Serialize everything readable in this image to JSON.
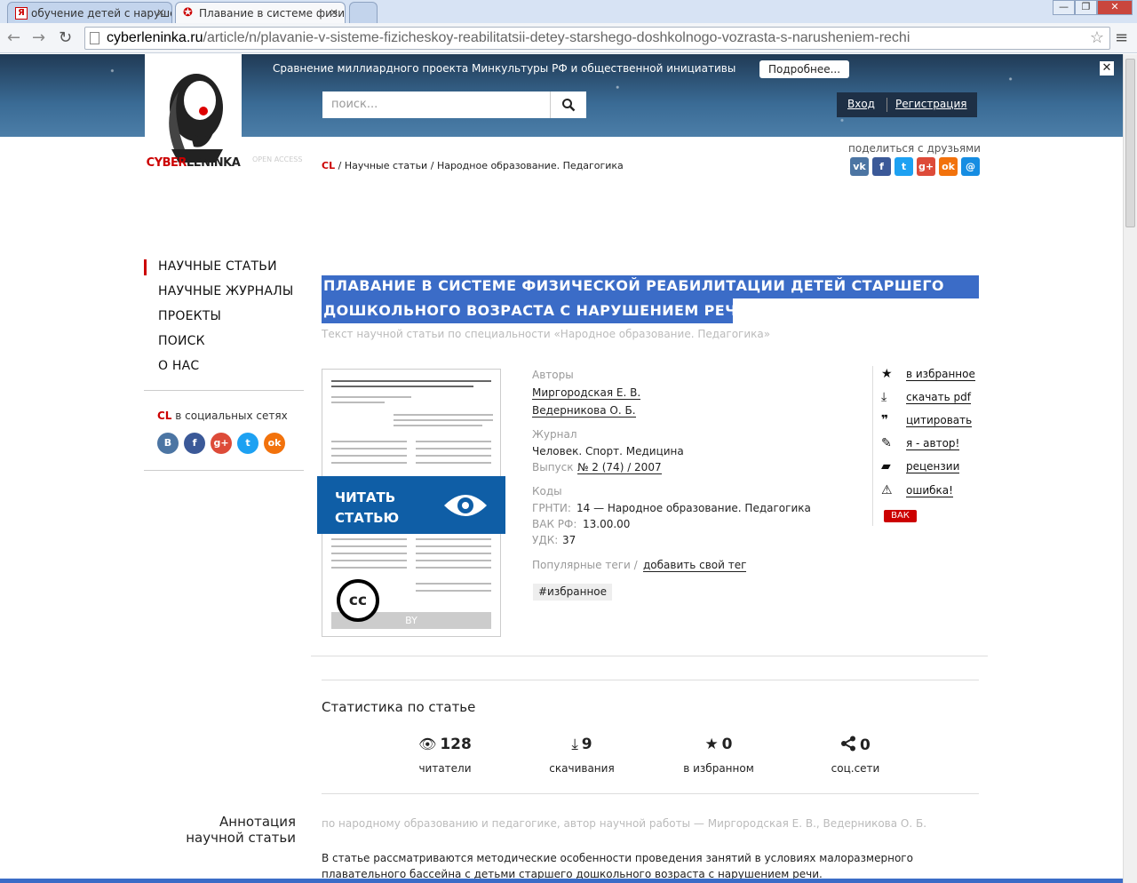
{
  "browser": {
    "tabs": [
      {
        "label": "обучение детей с нарушен",
        "close": "×"
      },
      {
        "label": "Плавание в системе физич",
        "close": "×"
      }
    ],
    "window_buttons": [
      "—",
      "❐",
      "✕"
    ],
    "url_host": "cyberleninka.ru",
    "url_path": "/article/n/plavanie-v-sisteme-fizicheskoy-reabilitatsii-detey-starshego-doshkolnogo-vozrasta-s-narusheniem-rechi"
  },
  "header": {
    "announcement": "Сравнение миллиардного проекта Минкультуры РФ и общественной инициативы",
    "more_button": "Подробнее...",
    "close": "✕",
    "search_placeholder": "поиск...",
    "login": "Вход",
    "register": "Регистрация",
    "logo_text_1": "CYBER",
    "logo_text_2": "LENINKA"
  },
  "breadcrumb": {
    "open_access": "OPEN ACCESS",
    "cl": "CL",
    "items": [
      "Научные статьи",
      "Народное образование. Педагогика"
    ],
    "separator": "/"
  },
  "share": {
    "label": "поделиться с друзьями",
    "icons": [
      {
        "name": "vk",
        "text": "vk",
        "color": "#4c75a3"
      },
      {
        "name": "facebook",
        "text": "f",
        "color": "#3b5998"
      },
      {
        "name": "twitter",
        "text": "t",
        "color": "#1da1f2"
      },
      {
        "name": "google-plus",
        "text": "g+",
        "color": "#dd4b39"
      },
      {
        "name": "odnoklassniki",
        "text": "ok",
        "color": "#f2720c"
      },
      {
        "name": "mail",
        "text": "@",
        "color": "#168de2"
      }
    ]
  },
  "nav": {
    "items": [
      "НАУЧНЫЕ СТАТЬИ",
      "НАУЧНЫЕ ЖУРНАЛЫ",
      "ПРОЕКТЫ",
      "ПОИСК",
      "О НАС"
    ],
    "social_cl": "CL",
    "social_label": "в социальных сетях",
    "social_icons": [
      {
        "name": "vk",
        "text": "B",
        "color": "#4c75a3"
      },
      {
        "name": "facebook",
        "text": "f",
        "color": "#3b5998"
      },
      {
        "name": "google-plus",
        "text": "g+",
        "color": "#dd4b39"
      },
      {
        "name": "twitter",
        "text": "t",
        "color": "#1da1f2"
      },
      {
        "name": "odnoklassniki",
        "text": "ok",
        "color": "#f2720c"
      }
    ]
  },
  "article": {
    "title_line1": "ПЛАВАНИЕ В СИСТЕМЕ ФИЗИЧЕСКОЙ РЕАБИЛИТАЦИИ ДЕТЕЙ СТАРШЕГО",
    "title_line2": "ДОШКОЛЬНОГО ВОЗРАСТА С НАРУШЕНИЕМ РЕЧИ",
    "subtitle": "Текст научной статьи по специальности «Народное образование. Педагогика»",
    "read_button_1": "ЧИТАТЬ",
    "read_button_2": "СТАТЬЮ",
    "cc": "cc",
    "by": "BY",
    "authors_label": "Авторы",
    "authors": [
      "Миргородская Е. В.",
      "Ведерникова О. Б."
    ],
    "journal_label": "Журнал",
    "journal": "Человек. Спорт. Медицина",
    "issue_label": "Выпуск",
    "issue": "№ 2 (74) / 2007",
    "codes_label": "Коды",
    "grnti_label": "ГРНТИ:",
    "grnti": "14 — Народное образование. Педагогика",
    "vak_label": "ВАК РФ:",
    "vak": "13.00.00",
    "udk_label": "УДК:",
    "udk": "37",
    "tags_label": "Популярные теги /",
    "add_tag": "добавить свой тег",
    "tag": "#избранное"
  },
  "actions": {
    "items": [
      {
        "icon": "★",
        "label": "в избранное"
      },
      {
        "icon": "⤓",
        "label": "скачать pdf"
      },
      {
        "icon": "❞",
        "label": "цитировать"
      },
      {
        "icon": "✎",
        "label": "я - автор!"
      },
      {
        "icon": "▰",
        "label": "рецензии"
      },
      {
        "icon": "⚠",
        "label": "ошибка!"
      }
    ],
    "vak_badge": "ВАК"
  },
  "stats": {
    "title": "Статистика по статье",
    "items": [
      {
        "icon": "👁",
        "value": "128",
        "label": "читатели"
      },
      {
        "icon": "⤓",
        "value": "9",
        "label": "скачивания"
      },
      {
        "icon": "★",
        "value": "0",
        "label": "в избранном"
      },
      {
        "icon": "⋖",
        "value": "0",
        "label": "соц.сети"
      }
    ]
  },
  "annotation": {
    "title_1": "Аннотация",
    "title_2": "научной статьи",
    "meta": "по народному образованию и педагогике, автор научной работы — Миргородская Е. В., Ведерникова О. Б.",
    "text": "В статье рассматриваются методические особенности проведения занятий в условиях малоразмерного плавательного бассейна с детьми старшего дошкольного возраста с нарушением речи."
  }
}
